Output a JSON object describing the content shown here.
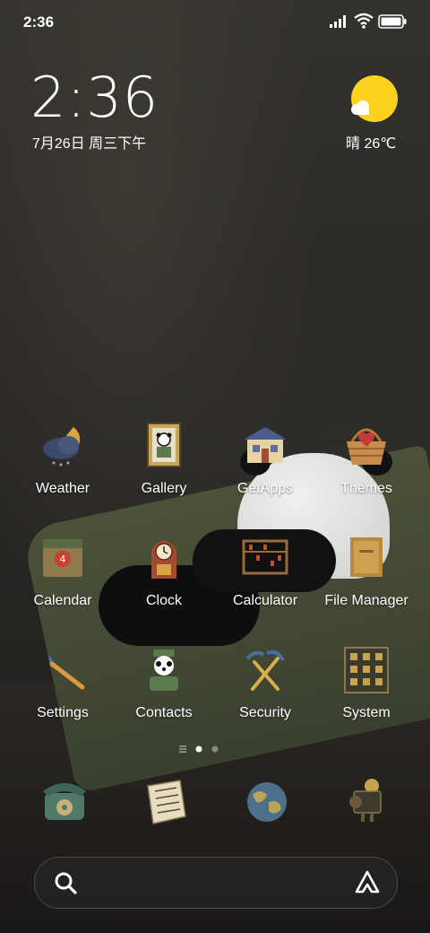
{
  "status_bar": {
    "time": "2:36",
    "icons": [
      "signal-icon",
      "wifi-icon",
      "battery-icon"
    ]
  },
  "clock_widget": {
    "time": "2:36",
    "date": "7月26日 周三下午"
  },
  "weather_widget": {
    "text": "晴 26℃",
    "icon": "sun-cloud-icon"
  },
  "apps": [
    {
      "label": "Weather",
      "icon": "weather-cloud-icon"
    },
    {
      "label": "Gallery",
      "icon": "gallery-frame-icon"
    },
    {
      "label": "GetApps",
      "icon": "getapps-house-icon"
    },
    {
      "label": "Themes",
      "icon": "themes-basket-icon"
    },
    {
      "label": "Calendar",
      "icon": "calendar-icon"
    },
    {
      "label": "Clock",
      "icon": "clock-icon"
    },
    {
      "label": "Calculator",
      "icon": "abacus-icon"
    },
    {
      "label": "File Manager",
      "icon": "folder-icon"
    },
    {
      "label": "Settings",
      "icon": "settings-brush-icon"
    },
    {
      "label": "Contacts",
      "icon": "contacts-panda-icon"
    },
    {
      "label": "Security",
      "icon": "security-pickaxe-icon"
    },
    {
      "label": "System",
      "icon": "system-grid-icon"
    }
  ],
  "page_indicator": {
    "pages": 2,
    "current": 1
  },
  "dock": [
    {
      "icon": "phone-icon"
    },
    {
      "icon": "messages-icon"
    },
    {
      "icon": "browser-globe-icon"
    },
    {
      "icon": "camera-icon"
    }
  ],
  "search_bar": {
    "icons": [
      "search-icon",
      "assistant-icon"
    ]
  },
  "colors": {
    "sun": "#ffd21f",
    "background": "#2b2926"
  }
}
